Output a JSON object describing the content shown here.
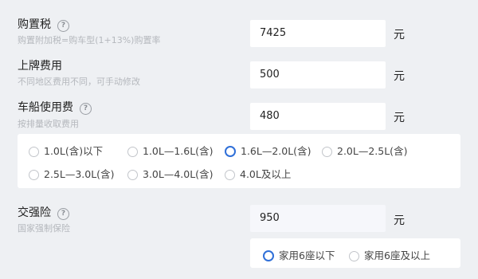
{
  "purchase_tax": {
    "label": "购置税",
    "help_icon": "question-circle-icon",
    "sublabel": "购置附加税=购车型(1+13%)购置率",
    "value": "7425",
    "unit": "元"
  },
  "license_fee": {
    "label": "上牌费用",
    "sublabel": "不同地区费用不同，可手动修改",
    "value": "500",
    "unit": "元"
  },
  "vehicle_tax": {
    "label": "车船使用费",
    "help_icon": "question-circle-icon",
    "sublabel": "按排量收取费用",
    "value": "480",
    "unit": "元",
    "options": [
      "1.0L(含)以下",
      "1.0L—1.6L(含)",
      "1.6L—2.0L(含)",
      "2.0L—2.5L(含)",
      "2.5L—3.0L(含)",
      "3.0L—4.0L(含)",
      "4.0L及以上"
    ],
    "selected": "1.6L—2.0L(含)"
  },
  "compulsory_insurance": {
    "label": "交强险",
    "help_icon": "question-circle-icon",
    "sublabel": "国家强制保险",
    "value": "950",
    "unit": "元",
    "options": [
      "家用6座以下",
      "家用6座及以上"
    ],
    "selected": "家用6座以下"
  },
  "colors": {
    "accent": "#2f6fd8",
    "background": "#eef0f3"
  }
}
